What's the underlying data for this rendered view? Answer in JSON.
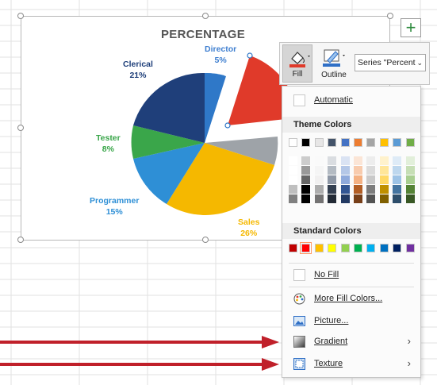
{
  "chart": {
    "title": "PERCENTAGE",
    "labels": [
      {
        "name": "Director",
        "pct": "5%",
        "color": "#3f7fd0"
      },
      {
        "name": "Clerical",
        "pct": "21%",
        "color": "#1f3f7a"
      },
      {
        "name": "Tester",
        "pct": "8%",
        "color": "#3aa64a"
      },
      {
        "name": "Programmer",
        "pct": "15%",
        "color": "#2e8fd6"
      },
      {
        "name": "Sales",
        "pct": "26%",
        "color": "#f5b800"
      }
    ],
    "plus_icon": "plus-icon"
  },
  "toolbar": {
    "fill_label": "Fill",
    "outline_label": "Outline",
    "series_select_value": "Series \"Percent",
    "fill_color": "#e03a2a",
    "outline_color": "#2f6fc6"
  },
  "menu": {
    "automatic": "Automatic",
    "theme_colors_header": "Theme Colors",
    "standard_colors_header": "Standard Colors",
    "no_fill": "No Fill",
    "more_fill_colors": "More Fill Colors...",
    "picture": "Picture...",
    "gradient": "Gradient",
    "texture": "Texture",
    "theme_top_row": [
      "#ffffff",
      "#000000",
      "#e7e6e6",
      "#44546a",
      "#4472c4",
      "#ed7d31",
      "#a5a5a5",
      "#ffc000",
      "#5b9bd5",
      "#70ad47"
    ],
    "standard_colors": [
      "#c00000",
      "#ff0000",
      "#ffc000",
      "#ffff00",
      "#92d050",
      "#00b050",
      "#00b0f0",
      "#0070c0",
      "#002060",
      "#7030a0"
    ]
  },
  "annotations": {
    "arrow_color": "#c0202a"
  }
}
